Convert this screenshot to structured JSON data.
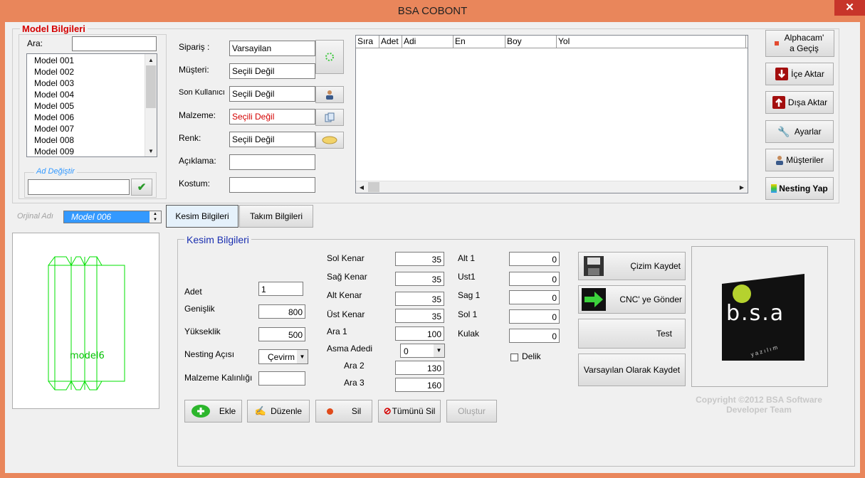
{
  "window": {
    "title": "BSA COBONT",
    "close_glyph": "✕"
  },
  "model_info": {
    "legend": "Model Bilgileri",
    "search_label": "Ara:",
    "search_value": "",
    "models": [
      "Model 001",
      "Model 002",
      "Model 003",
      "Model 004",
      "Model 005",
      "Model 006",
      "Model 007",
      "Model 008",
      "Model 009"
    ],
    "rename_legend": "Ad Değiştir",
    "rename_value": ""
  },
  "fields": {
    "siparis_label": "Sipariş :",
    "siparis_value": "Varsayilan",
    "musteri_label": "Müşteri:",
    "musteri_value": "Seçili Değil",
    "son_kullanici_label": "Son Kullanıcı",
    "son_kullanici_value": "Seçili Değil",
    "malzeme_label": "Malzeme:",
    "malzeme_value": "Seçili Değil",
    "renk_label": "Renk:",
    "renk_value": "Seçili Değil",
    "aciklama_label": "Açıklama:",
    "aciklama_value": "",
    "kostum_label": "Kostum:",
    "kostum_value": ""
  },
  "grid": {
    "columns": [
      "Sıra",
      "Adet",
      "Adi",
      "En",
      "Boy",
      "Yol"
    ]
  },
  "right_buttons": {
    "alphacam": "Alphacam' a Geçiş",
    "ice_aktar": "İçe Aktar",
    "disa_aktar": "Dışa Aktar",
    "ayarlar": "Ayarlar",
    "musteriler": "Müşteriler",
    "nesting_yap": "Nesting Yap"
  },
  "original_name": {
    "label": "Orjinal Adı",
    "value": "Model 006"
  },
  "tabs": {
    "kesim": "Kesim Bilgileri",
    "takim": "Takım Bilgileri"
  },
  "preview": {
    "text": "model6"
  },
  "cut_info": {
    "legend": "Kesim Bilgileri",
    "adet_label": "Adet",
    "adet_value": "1",
    "genislik_label": "Genişlik",
    "genislik_value": "800",
    "yukseklik_label": "Yükseklik",
    "yukseklik_value": "500",
    "nesting_label": "Nesting Açısı",
    "nesting_value": "Çevirm",
    "kalinlik_label": "Malzeme Kalınlığı",
    "kalinlik_value": "",
    "sol_kenar_label": "Sol Kenar",
    "sol_kenar_value": "35",
    "sag_kenar_label": "Sağ Kenar",
    "sag_kenar_value": "35",
    "alt_kenar_label": "Alt Kenar",
    "alt_kenar_value": "35",
    "ust_kenar_label": "Üst Kenar",
    "ust_kenar_value": "35",
    "ara1_label": "Ara 1",
    "ara1_value": "100",
    "asma_label": "Asma Adedi",
    "asma_value": "0",
    "ara2_label": "Ara 2",
    "ara2_value": "130",
    "ara3_label": "Ara 3",
    "ara3_value": "160",
    "alt1_label": "Alt 1",
    "alt1_value": "0",
    "ust1_label": "Ust1",
    "ust1_value": "0",
    "sag1_label": "Sag 1",
    "sag1_value": "0",
    "sol1_label": "Sol 1",
    "sol1_value": "0",
    "kulak_label": "Kulak",
    "kulak_value": "0",
    "delik_label": "Delik"
  },
  "action_buttons": {
    "cizim_kaydet": "Çizim Kaydet",
    "cnc_gonder": "CNC' ye Gönder",
    "test": "Test",
    "varsayilan_kaydet": "Varsayılan Olarak Kaydet"
  },
  "bottom_buttons": {
    "ekle": "Ekle",
    "duzenle": "Düzenle",
    "sil": "Sil",
    "tumunu_sil": "Tümünü Sil",
    "olustur": "Oluştur"
  },
  "logo": {
    "text": "b.s.a",
    "subtext": "y a z ı l ı m"
  },
  "copyright": {
    "line1": "Copyright ©2012 BSA Software",
    "line2": "Developer Team"
  },
  "colors": {
    "title_bar": "#e9865b",
    "close": "#c7352a",
    "accent_red": "#d40000",
    "selection_blue": "#3399ff"
  }
}
